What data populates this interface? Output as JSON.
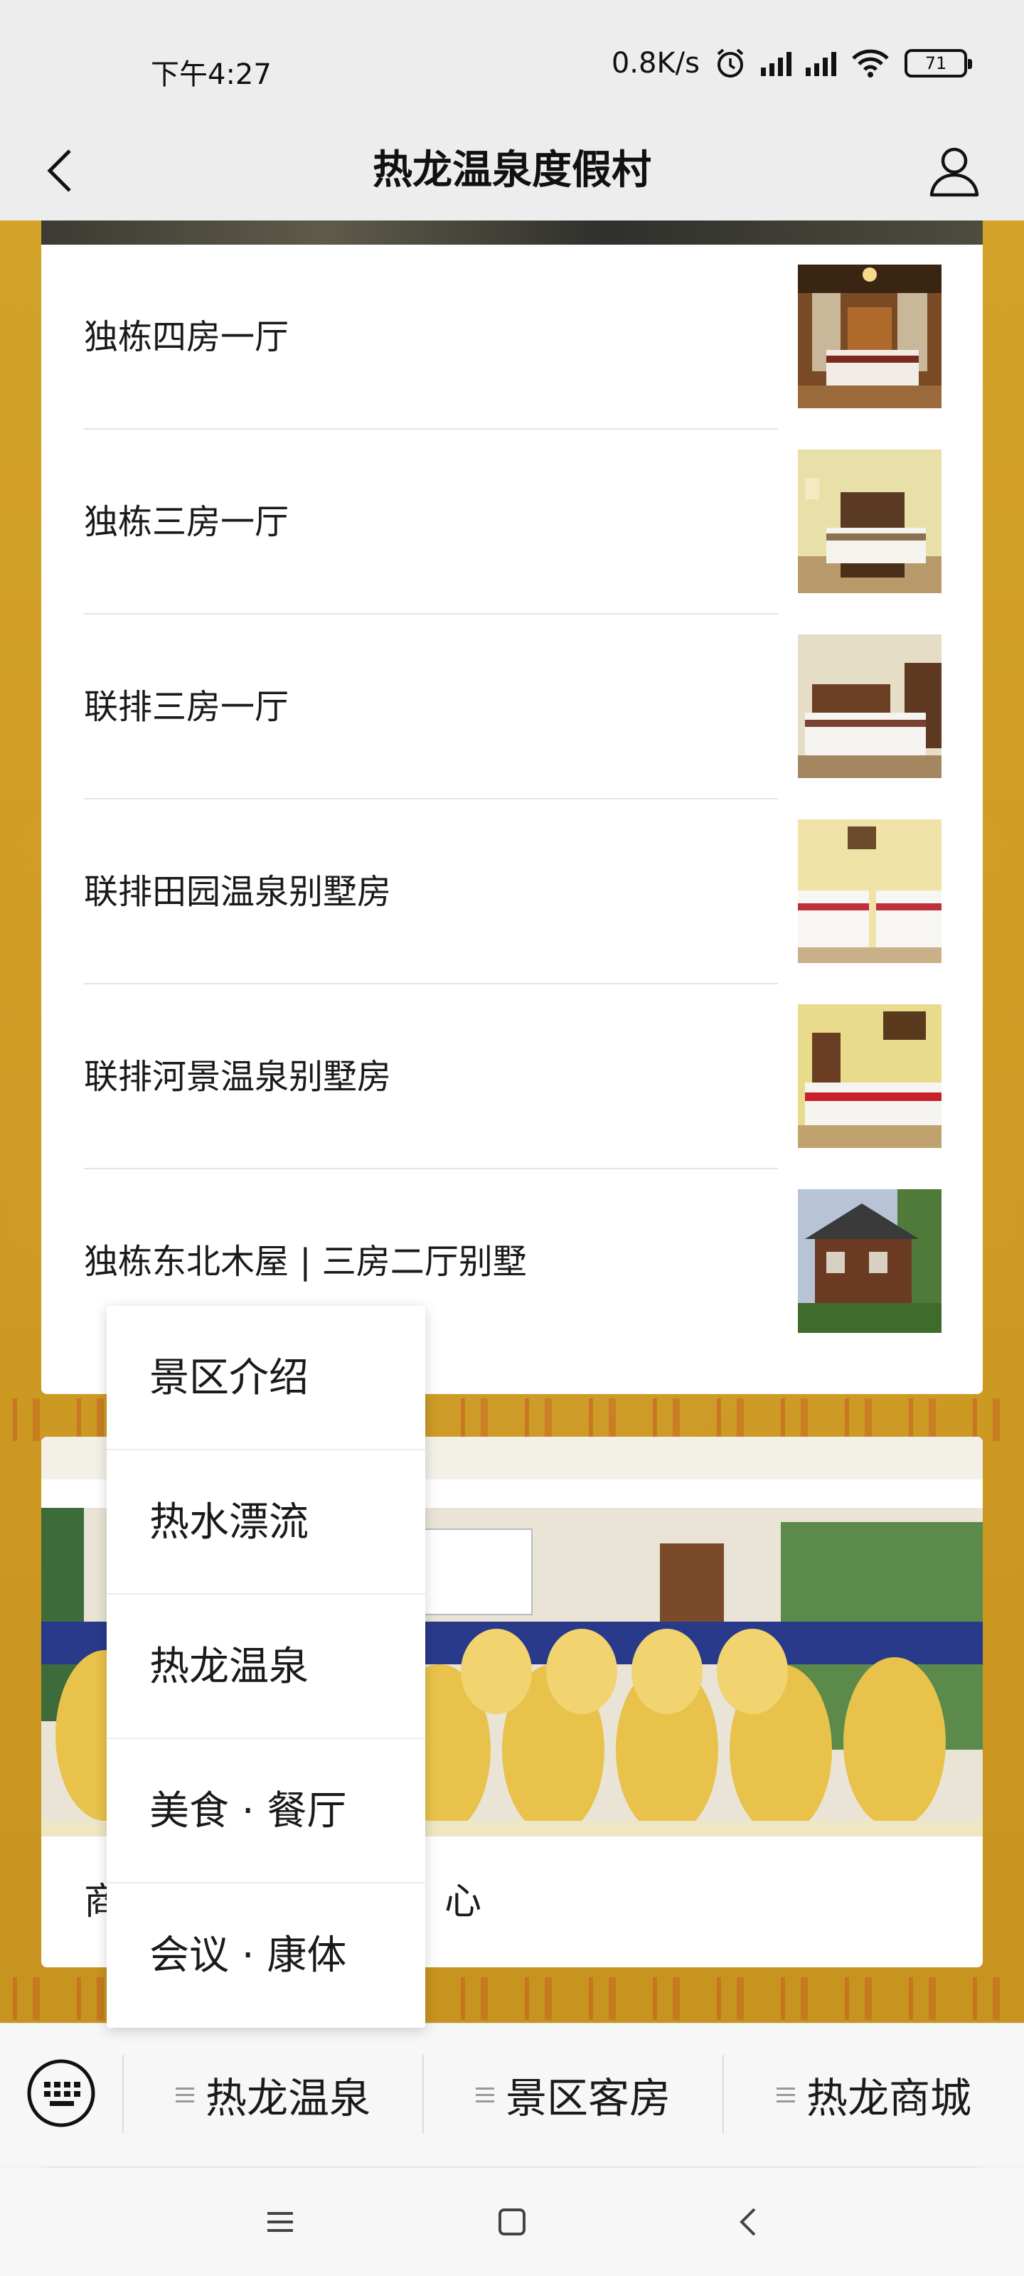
{
  "status_bar": {
    "time": "下午4:27",
    "network_speed": "0.8K/s",
    "battery_level": "71",
    "icons": [
      "alarm-icon",
      "hd-signal-icon",
      "signal-icon",
      "wifi-icon",
      "battery-icon"
    ]
  },
  "nav": {
    "title": "热龙温泉度假村",
    "back_icon": "back-arrow-icon",
    "user_icon": "user-icon"
  },
  "rooms": [
    {
      "name": "独栋四房一厅",
      "thumb": "room-photo"
    },
    {
      "name": "独栋三房一厅",
      "thumb": "room-photo"
    },
    {
      "name": "联排三房一厅",
      "thumb": "room-photo"
    },
    {
      "name": "联排田园温泉别墅房",
      "thumb": "room-photo"
    },
    {
      "name": "联排河景温泉别墅房",
      "thumb": "room-photo"
    },
    {
      "name": "独栋东北木屋 | 三房二厅别墅",
      "thumb": "cabin-photo"
    }
  ],
  "hall": {
    "caption_left": "商",
    "caption_right": "心"
  },
  "popup_menu": {
    "items": [
      "景区介绍",
      "热水漂流",
      "热龙温泉",
      "美食 · 餐厅",
      "会议 · 康体"
    ]
  },
  "bottom_menu": {
    "keyboard_icon": "keyboard-icon",
    "tabs": [
      "热龙温泉",
      "景区客房",
      "热龙商城"
    ]
  },
  "system_nav": {
    "icons": [
      "menu-icon",
      "home-icon",
      "back-icon"
    ]
  },
  "colors": {
    "background_gold": "#cf9c22",
    "bar_gray": "#ededed",
    "card_white": "#ffffff"
  }
}
